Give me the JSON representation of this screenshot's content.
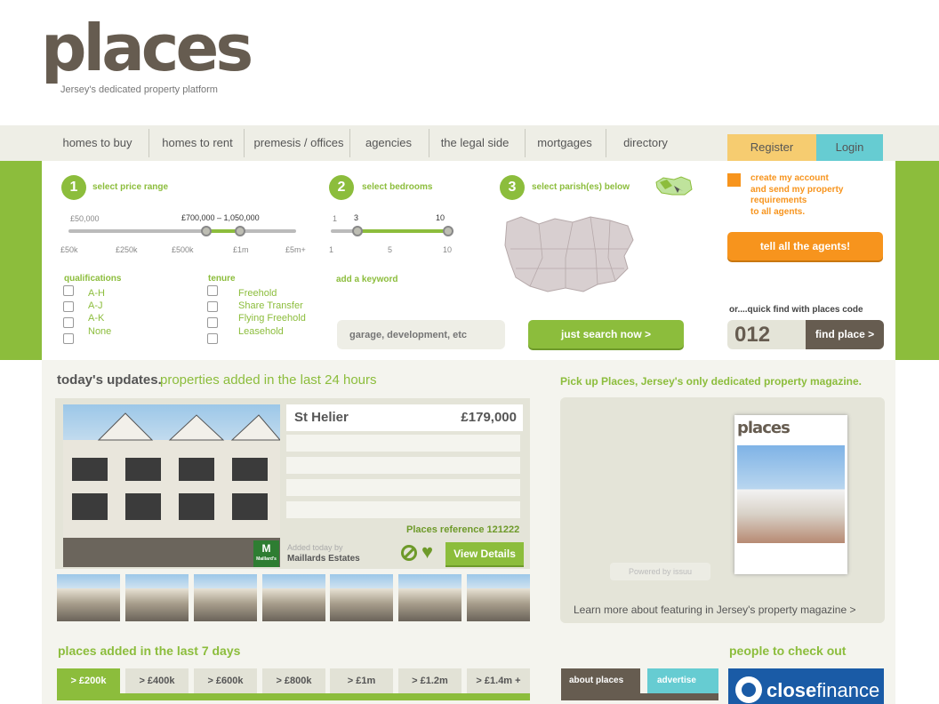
{
  "brand": {
    "logo": "places",
    "tagline": "Jersey's dedicated property platform"
  },
  "nav": {
    "items": [
      "homes to buy",
      "homes to rent",
      "premesis / offices",
      "agencies",
      "the legal side",
      "mortgages",
      "directory"
    ]
  },
  "account": {
    "register": "Register",
    "login": "Login"
  },
  "search": {
    "step1": {
      "num": "1",
      "label": "select price range",
      "range_min": "£50,000",
      "range_value": "£700,000 – 1,050,000",
      "ticks": [
        "£50k",
        "£250k",
        "£500k",
        "£1m",
        "£5m+"
      ]
    },
    "step2": {
      "num": "2",
      "label": "select bedrooms",
      "min": "1",
      "low": "3",
      "high": "10",
      "ticks": [
        "1",
        "5",
        "10"
      ]
    },
    "step3": {
      "num": "3",
      "label": "select parish(es) below"
    },
    "qualifications": {
      "title": "qualifications",
      "options": [
        "A-H",
        "A-J",
        "A-K",
        "None"
      ]
    },
    "tenure": {
      "title": "tenure",
      "options": [
        "Freehold",
        "Share Transfer",
        "Flying Freehold",
        "Leasehold"
      ]
    },
    "keyword": {
      "label": "add a keyword",
      "placeholder": "garage, development, etc"
    },
    "submit": "just search now >"
  },
  "agents": {
    "text": [
      "create my account",
      "and send my property",
      "requirements",
      "to all agents."
    ],
    "button": "tell all the agents!"
  },
  "quickfind": {
    "label": "or....quick find with places code",
    "value": "012",
    "button": "find place >"
  },
  "updates": {
    "title": "today's updates.",
    "subtitle": "properties added in the last 24 hours"
  },
  "featured": {
    "location": "St Helier",
    "price": "£179,000",
    "reference": "Places reference 121222",
    "added_label": "Added today by",
    "agent": "Maillards Estates",
    "agent_logo": "M",
    "agent_logo_sub": "Maillard's",
    "cta": "View Details"
  },
  "magazine": {
    "heading": "Pick up Places, Jersey's only dedicated property magazine.",
    "cover_title": "places",
    "powered": "Powered by issuu",
    "link": "Learn more about featuring in Jersey's property magazine >"
  },
  "week": {
    "title": "places added in the last 7 days",
    "tabs": [
      "> £200k",
      "> £400k",
      "> £600k",
      "> £800k",
      "> £1m",
      "> £1.2m",
      "> £1.4m +"
    ]
  },
  "about_tabs": {
    "about": "about places",
    "advertise": "advertise"
  },
  "people": {
    "title": "people to check out",
    "sponsor_part1": "close",
    "sponsor_part2": "finance"
  },
  "colors": {
    "green": "#8cbd3c",
    "orange": "#f7941d",
    "brown": "#665c50",
    "teal": "#66ccd2",
    "yellow": "#f6cc70"
  }
}
